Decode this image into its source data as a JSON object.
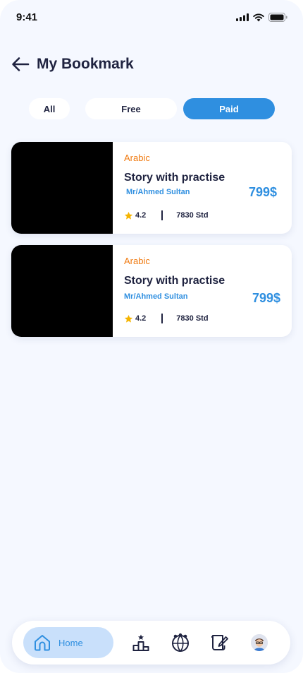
{
  "status_bar": {
    "time": "9:41"
  },
  "header": {
    "title": "My Bookmark"
  },
  "tabs": [
    {
      "label": "All"
    },
    {
      "label": "Free"
    },
    {
      "label": "Paid"
    }
  ],
  "courses": [
    {
      "category": "Arabic",
      "title": "Story with practise",
      "instructor": "Mr/Ahmed Sultan",
      "price": "799$",
      "rating": "4.2",
      "students": "7830 Std"
    },
    {
      "category": "Arabic",
      "title": "Story with practise",
      "instructor": "Mr/Ahmed Sultan",
      "price": "799$",
      "rating": "4.2",
      "students": "7830 Std"
    }
  ],
  "bottom_nav": {
    "home_label": "Home"
  },
  "colors": {
    "accent": "#2f8fe0",
    "category": "#f07a10",
    "star": "#f5b400",
    "background": "#f5f8ff"
  }
}
